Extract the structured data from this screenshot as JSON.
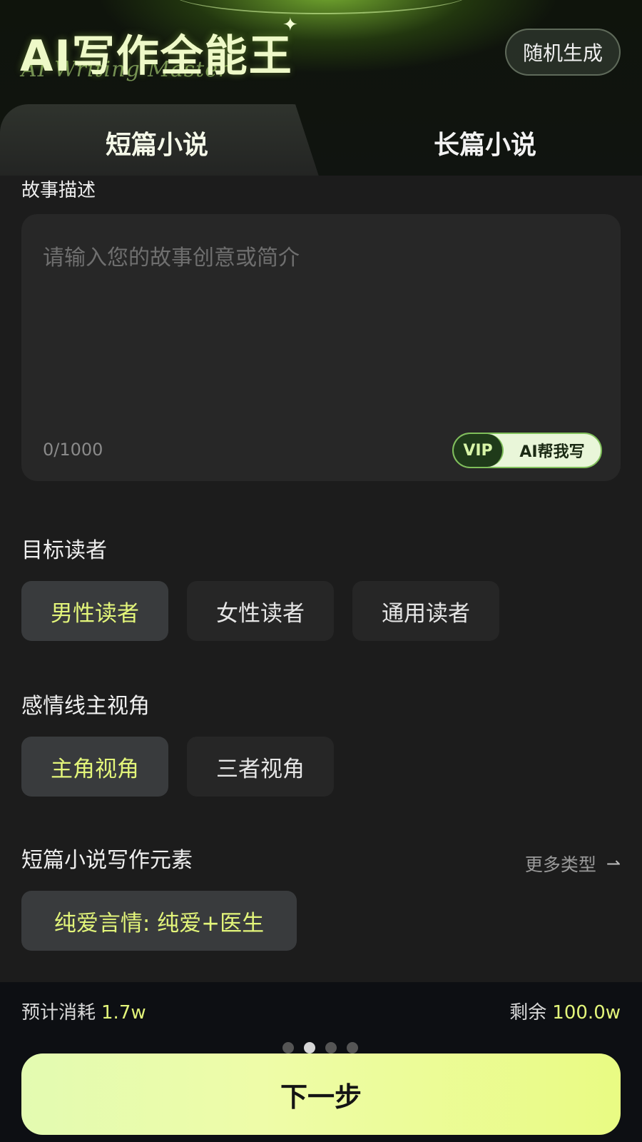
{
  "header": {
    "app_title": "AI写作全能王",
    "app_subtitle": "AI Writing Master",
    "random_button": "随机生成"
  },
  "tabs": [
    {
      "label": "短篇小说",
      "active": true
    },
    {
      "label": "长篇小说",
      "active": false
    }
  ],
  "story": {
    "label": "故事描述",
    "placeholder": "请输入您的故事创意或简介",
    "char_count": "0/1000",
    "vip_badge": "VIP",
    "ai_help": "AI帮我写"
  },
  "target_reader": {
    "label": "目标读者",
    "options": [
      {
        "label": "男性读者",
        "selected": true
      },
      {
        "label": "女性读者",
        "selected": false
      },
      {
        "label": "通用读者",
        "selected": false
      }
    ]
  },
  "perspective": {
    "label": "感情线主视角",
    "options": [
      {
        "label": "主角视角",
        "selected": true
      },
      {
        "label": "三者视角",
        "selected": false
      }
    ]
  },
  "elements": {
    "label": "短篇小说写作元素",
    "more": "更多类型",
    "selected_chip": "纯爱言情: 纯爱+医生"
  },
  "footer": {
    "cost_label": "预计消耗",
    "cost_value": "1.7w",
    "remain_label": "剩余",
    "remain_value": "100.0w",
    "next_button": "下一步"
  },
  "pager": {
    "count": 4,
    "active_index": 1
  },
  "colors": {
    "accent": "#e3f57a",
    "background": "#1c1c1c",
    "button_gradient_start": "#e3fbb1",
    "button_gradient_end": "#e9fb83"
  },
  "icons": [
    "sparkle-icon",
    "arrow-right-icon"
  ]
}
